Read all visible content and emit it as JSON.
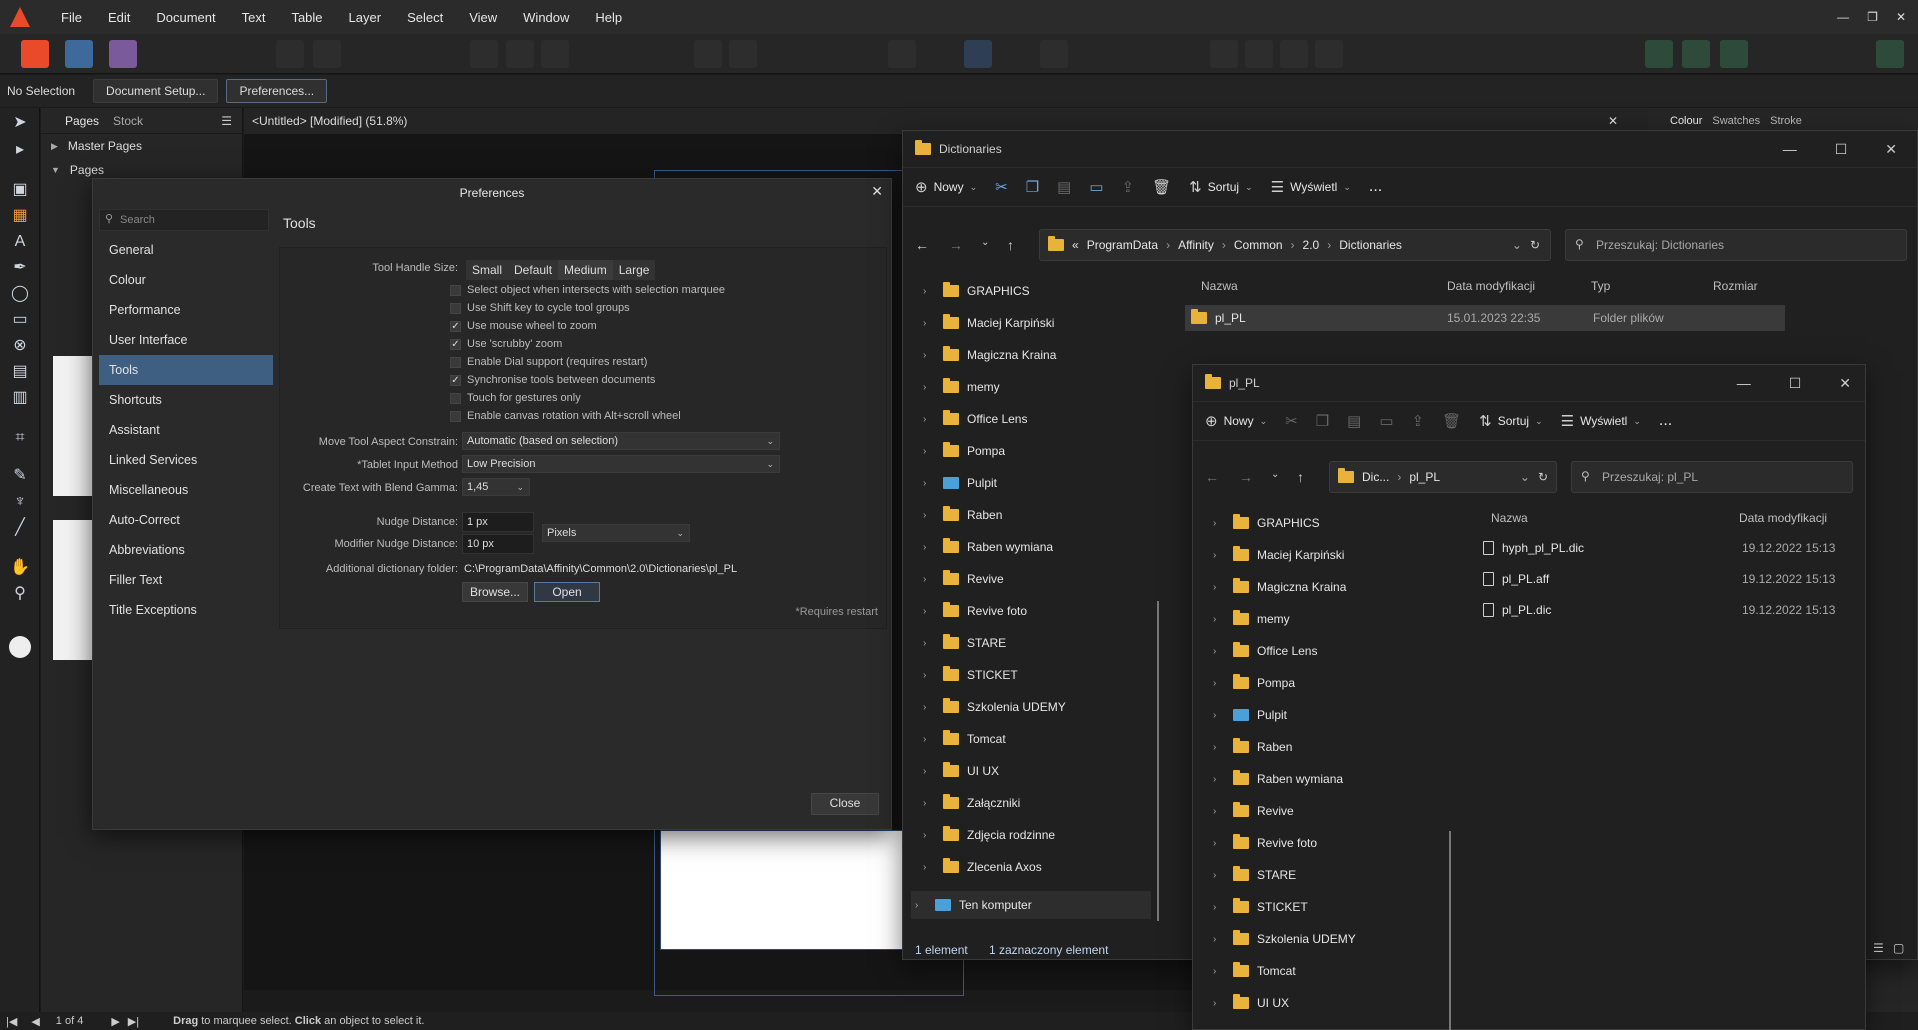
{
  "app": {
    "menu": [
      "File",
      "Edit",
      "Document",
      "Text",
      "Table",
      "Layer",
      "Select",
      "View",
      "Window",
      "Help"
    ],
    "window_controls": [
      "—",
      "❐",
      "✕"
    ],
    "context": {
      "selection": "No Selection",
      "doc_setup": "Document Setup...",
      "prefs_btn": "Preferences..."
    },
    "pages_panel": {
      "tabs": [
        "Pages",
        "Stock"
      ],
      "rows": [
        "Master Pages",
        "Pages"
      ]
    },
    "doc_tab": "<Untitled> [Modified] (51.8%)",
    "right_tabs": [
      "Colour",
      "Swatches",
      "Stroke"
    ],
    "status": {
      "page": "1 of 4",
      "hint_drag": "Drag",
      "hint_mid": " to marquee select. ",
      "hint_click": "Click",
      "hint_end": " an object to select it."
    },
    "accent": "#3e5f82",
    "brand": "#e84a2a"
  },
  "prefs": {
    "title": "Preferences",
    "search_placeholder": "Search",
    "categories": [
      "General",
      "Colour",
      "Performance",
      "User Interface",
      "Tools",
      "Shortcuts",
      "Assistant",
      "Linked Services",
      "Miscellaneous",
      "Auto-Correct",
      "Abbreviations",
      "Filler Text",
      "Title Exceptions"
    ],
    "selected": "Tools",
    "pane_title": "Tools",
    "handle_label": "Tool Handle Size:",
    "handle_sizes": [
      "Small",
      "Default",
      "Medium",
      "Large"
    ],
    "handle_selected": "Medium",
    "checks": [
      {
        "label": "Select object when intersects with selection marquee",
        "checked": false
      },
      {
        "label": "Use Shift key to cycle tool groups",
        "checked": false
      },
      {
        "label": "Use mouse wheel to zoom",
        "checked": true
      },
      {
        "label": "Use 'scrubby' zoom",
        "checked": true
      },
      {
        "label": "Enable Dial support (requires restart)",
        "checked": false
      },
      {
        "label": "Synchronise tools between documents",
        "checked": true
      },
      {
        "label": "Touch for gestures only",
        "checked": false
      },
      {
        "label": "Enable canvas rotation with Alt+scroll wheel",
        "checked": false
      }
    ],
    "move_label": "Move Tool Aspect Constrain:",
    "move_value": "Automatic (based on selection)",
    "tablet_label": "*Tablet Input Method",
    "tablet_value": "Low Precision",
    "gamma_label": "Create Text with Blend Gamma:",
    "gamma_value": "1,45",
    "nudge_label": "Nudge Distance:",
    "nudge_value": "1 px",
    "mod_nudge_label": "Modifier Nudge Distance:",
    "mod_nudge_value": "10 px",
    "unit_value": "Pixels",
    "dict_label": "Additional dictionary folder:",
    "dict_value": "C:\\ProgramData\\Affinity\\Common\\2.0\\Dictionaries\\pl_PL",
    "browse": "Browse...",
    "open": "Open",
    "restart_note": "*Requires restart",
    "close": "Close"
  },
  "exp1": {
    "title": "Dictionaries",
    "cmd": {
      "new": "Nowy",
      "sort": "Sortuj",
      "view": "Wyświetl",
      "more": "..."
    },
    "path": [
      "ProgramData",
      "Affinity",
      "Common",
      "2.0",
      "Dictionaries"
    ],
    "path_prefix": "«",
    "search": "Przeszukaj: Dictionaries",
    "tree": [
      "GRAPHICS",
      "Maciej Karpiński",
      "Magiczna Kraina",
      "memy",
      "Office Lens",
      "Pompa",
      "Pulpit",
      "Raben",
      "Raben wymiana",
      "Revive",
      "Revive foto",
      "STARE",
      "STICKET",
      "Szkolenia UDEMY",
      "Tomcat",
      "UI UX",
      "Załączniki",
      "Zdjęcia rodzinne",
      "Zlecenia Axos"
    ],
    "tree_pc": "Ten komputer",
    "cols": [
      "Nazwa",
      "Data modyfikacji",
      "Typ",
      "Rozmiar"
    ],
    "row": {
      "name": "pl_PL",
      "date": "15.01.2023 22:35",
      "type": "Folder plików"
    },
    "status_count": "1 element",
    "status_sel": "1 zaznaczony element"
  },
  "exp2": {
    "title": "pl_PL",
    "cmd": {
      "new": "Nowy",
      "sort": "Sortuj",
      "view": "Wyświetl",
      "more": "..."
    },
    "path": [
      "Dic...",
      "pl_PL"
    ],
    "search": "Przeszukaj: pl_PL",
    "tree": [
      "GRAPHICS",
      "Maciej Karpiński",
      "Magiczna Kraina",
      "memy",
      "Office Lens",
      "Pompa",
      "Pulpit",
      "Raben",
      "Raben wymiana",
      "Revive",
      "Revive foto",
      "STARE",
      "STICKET",
      "Szkolenia UDEMY",
      "Tomcat",
      "UI UX"
    ],
    "cols": [
      "Nazwa",
      "Data modyfikacji"
    ],
    "files": [
      {
        "name": "hyph_pl_PL.dic",
        "date": "19.12.2022 15:13"
      },
      {
        "name": "pl_PL.aff",
        "date": "19.12.2022 15:13"
      },
      {
        "name": "pl_PL.dic",
        "date": "19.12.2022 15:13"
      }
    ]
  }
}
